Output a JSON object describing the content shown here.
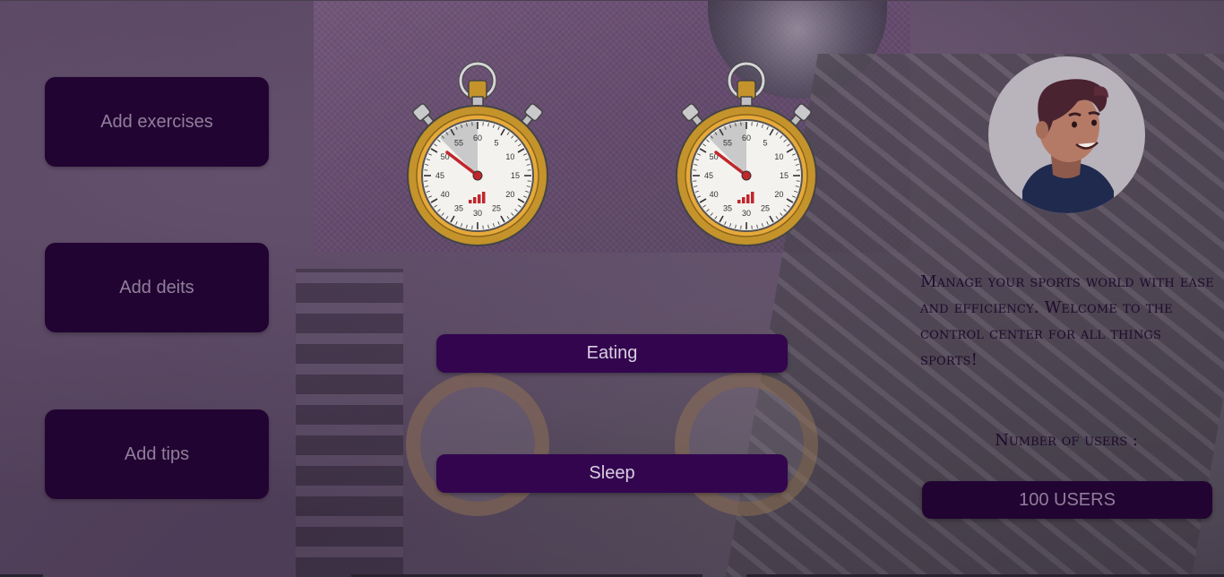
{
  "sidebar": {
    "items": [
      {
        "label": "Add exercises"
      },
      {
        "label": "Add deits"
      },
      {
        "label": "Add tips"
      }
    ]
  },
  "main": {
    "timers": [
      {
        "icon": "stopwatch-icon"
      },
      {
        "icon": "stopwatch-icon"
      }
    ],
    "stopwatch_numbers": [
      "60",
      "5",
      "10",
      "15",
      "20",
      "25",
      "30",
      "35",
      "40",
      "45",
      "50",
      "55"
    ],
    "actions": [
      {
        "label": "Eating"
      },
      {
        "label": "Sleep"
      }
    ]
  },
  "profile": {
    "avatar_icon": "user-avatar-icon",
    "welcome_text": "Manage your sports world with ease and efficiency. Welcome to the control center for all things sports!",
    "users_label": "Number of users :",
    "users_count": "100 USERS"
  },
  "colors": {
    "button_dark": "#220433",
    "button_accent": "#33054f",
    "stopwatch_gold": "#c4932b",
    "needle_red": "#c0262c"
  }
}
